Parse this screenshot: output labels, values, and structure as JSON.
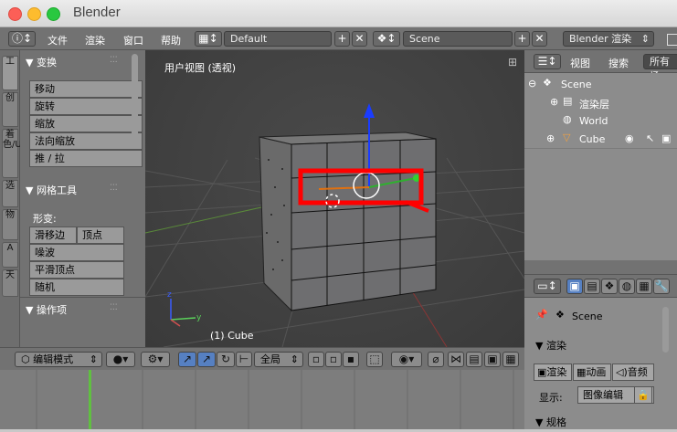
{
  "window": {
    "title": "Blender"
  },
  "menubar": {
    "menus": [
      "文件",
      "渲染",
      "窗口",
      "帮助"
    ],
    "screen_layout": "Default",
    "scene": "Scene",
    "render_engine": "Blender 渲染"
  },
  "toolshelf": {
    "tabs": [
      "工",
      "创",
      "着色/UV",
      "选",
      "物",
      "A",
      "天"
    ],
    "transform_header": "▼ 变换",
    "transform_buttons": [
      "移动",
      "旋转",
      "缩放",
      "法向缩放",
      "推 / 拉"
    ],
    "mesh_tools_header": "▼ 网格工具",
    "deform_label": "形变:",
    "slide_edge": "滑移边",
    "vertex": "顶点",
    "mesh_buttons": [
      "噪波",
      "平滑顶点",
      "随机"
    ],
    "operator_header": "▼ 操作项"
  },
  "viewport": {
    "view_label": "用户视图 (透视)",
    "object_label": "(1) Cube"
  },
  "view3d_header": {
    "mode": "编辑模式",
    "orientation": "全局"
  },
  "outliner": {
    "view": "视图",
    "search": "搜索",
    "filter": "所有场",
    "tree": [
      {
        "label": "Scene",
        "indent": 0
      },
      {
        "label": "渲染层",
        "indent": 1
      },
      {
        "label": "World",
        "indent": 1
      },
      {
        "label": "Cube",
        "indent": 1
      }
    ]
  },
  "properties": {
    "context": "Scene",
    "render_header": "▼ 渲染",
    "render_btn": "渲染",
    "anim_btn": "动画",
    "audio_btn": "音频",
    "display_label": "显示:",
    "display_value": "图像编辑",
    "dimensions_header": "▼ 规格"
  },
  "colors": {
    "selection_box": "#ff0000",
    "z_axis": "#1a3cff",
    "timeline_frame": "#60c040"
  }
}
